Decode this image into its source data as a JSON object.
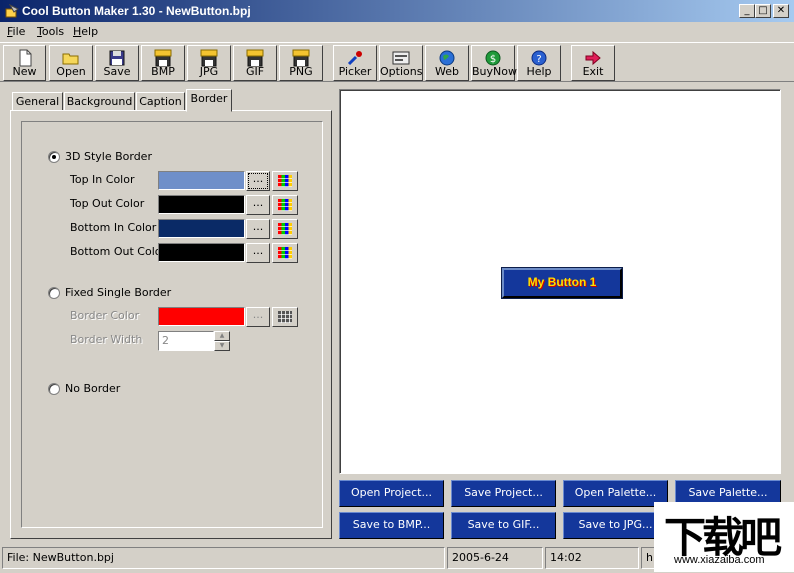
{
  "window": {
    "title": "Cool Button Maker 1.30 - NewButton.bpj"
  },
  "menu": [
    "File",
    "Tools",
    "Help"
  ],
  "toolbar": [
    {
      "label": "New",
      "icon": "new-file-icon"
    },
    {
      "label": "Open",
      "icon": "open-folder-icon"
    },
    {
      "label": "Save",
      "icon": "save-disk-icon"
    },
    {
      "label": "BMP",
      "icon": "bmp-disk-icon"
    },
    {
      "label": "JPG",
      "icon": "jpg-disk-icon"
    },
    {
      "label": "GIF",
      "icon": "gif-disk-icon"
    },
    {
      "label": "PNG",
      "icon": "png-disk-icon"
    },
    {
      "label": "Picker",
      "icon": "color-picker-icon"
    },
    {
      "label": "Options",
      "icon": "options-icon"
    },
    {
      "label": "Web",
      "icon": "globe-icon"
    },
    {
      "label": "BuyNow",
      "icon": "dollar-icon"
    },
    {
      "label": "Help",
      "icon": "help-icon"
    },
    {
      "label": "Exit",
      "icon": "exit-arrow-icon"
    }
  ],
  "tabs": [
    "General",
    "Background",
    "Caption",
    "Border"
  ],
  "active_tab": "Border",
  "border": {
    "style_3d_label": "3D Style Border",
    "top_in_label": "Top In Color",
    "top_out_label": "Top Out Color",
    "bottom_in_label": "Bottom In Color",
    "bottom_out_label": "Bottom Out Color",
    "fixed_label": "Fixed Single Border",
    "border_color_label": "Border Color",
    "border_width_label": "Border Width",
    "border_width_value": "2",
    "no_border_label": "No Border",
    "dots": "...",
    "colors": {
      "top_in": "#6f8fc9",
      "top_out": "#000000",
      "bottom_in": "#0a2a66",
      "bottom_out": "#000000",
      "fixed": "#ff0000"
    },
    "selected": "3d"
  },
  "preview": {
    "button_caption": "My Button 1",
    "caption_color": "#ffde00",
    "face_color": "#14379b"
  },
  "actions": {
    "open_project": "Open Project...",
    "save_project": "Save Project...",
    "open_palette": "Open Palette...",
    "save_palette": "Save Palette...",
    "save_bmp": "Save to BMP...",
    "save_gif": "Save to GIF...",
    "save_jpg": "Save to JPG..."
  },
  "status": {
    "file": "File:  NewButton.bpj",
    "date": "2005-6-24",
    "time": "14:02",
    "extra": "h"
  },
  "watermark": {
    "text": "下载吧",
    "url": "www.xiazaiba.com"
  }
}
